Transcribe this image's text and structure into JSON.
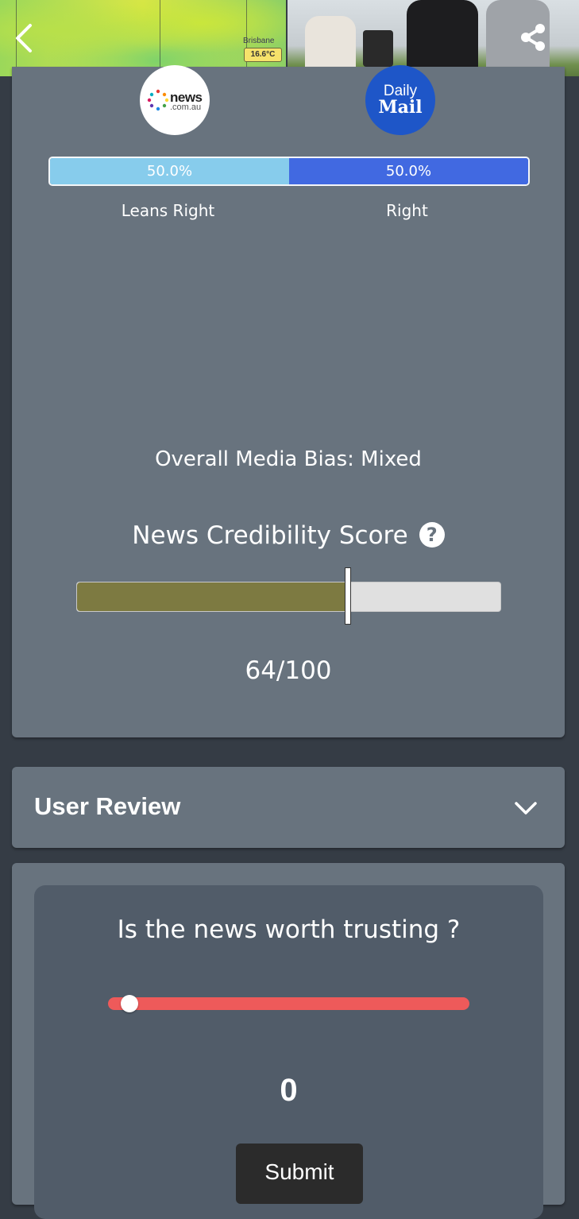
{
  "hero": {
    "map_city": "Brisbane",
    "map_temperature": "16.6°C"
  },
  "navigation": {
    "back_icon": "chevron-left-icon",
    "share_icon": "share-icon"
  },
  "sources": {
    "left": {
      "name": "news.com.au",
      "logo_word": "news",
      "logo_sub": ".com.au"
    },
    "right": {
      "name": "Daily Mail",
      "logo_word_top": "Daily",
      "logo_word_bottom": "Mail"
    }
  },
  "bias_bar": {
    "segments": [
      {
        "label": "Leans Right",
        "percent_text": "50.0%",
        "percent": 50.0,
        "color": "#87ccec"
      },
      {
        "label": "Right",
        "percent_text": "50.0%",
        "percent": 50.0,
        "color": "#4169e1"
      }
    ]
  },
  "overall_bias": "Overall Media Bias: Mixed",
  "credibility": {
    "title": "News Credibility Score",
    "help_icon": "question-circle-icon",
    "score": 64,
    "max": 100,
    "score_text": "64/100",
    "fill_color": "#7d7a41"
  },
  "user_review": {
    "title": "User Review",
    "toggle_icon": "chevron-down-icon"
  },
  "trust_poll": {
    "question": "Is the news worth trusting ?",
    "slider_value": 0,
    "slider_fraction": 0.06,
    "value_text": "0",
    "track_color": "#ee5a5a",
    "submit_label": "Submit"
  }
}
